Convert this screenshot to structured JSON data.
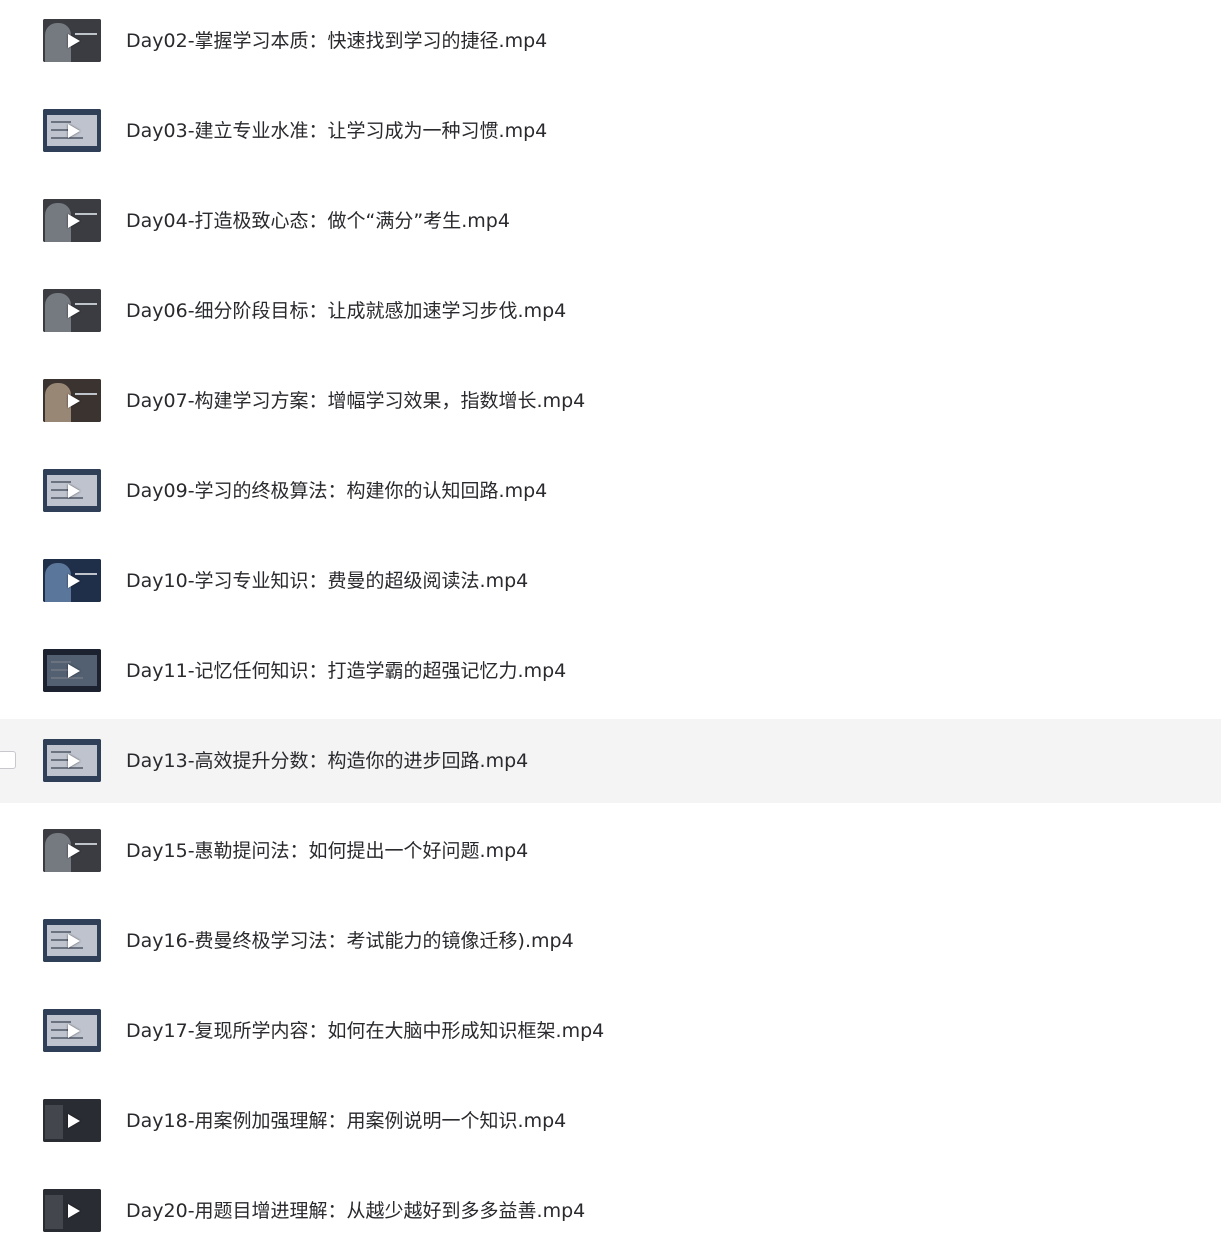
{
  "files": [
    {
      "name": "Day02-掌握学习本质：快速找到学习的捷径.mp4",
      "thumb": "portrait-dark",
      "thumbnail_icon": "play-icon"
    },
    {
      "name": "Day03-建立专业水准：让学习成为一种习惯.mp4",
      "thumb": "slide-light",
      "thumbnail_icon": "play-icon"
    },
    {
      "name": "Day04-打造极致心态：做个“满分”考生.mp4",
      "thumb": "portrait-dark",
      "thumbnail_icon": "play-icon"
    },
    {
      "name": "Day06-细分阶段目标：让成就感加速学习步伐.mp4",
      "thumb": "portrait-dark",
      "thumbnail_icon": "play-icon"
    },
    {
      "name": "Day07-构建学习方案：增幅学习效果，指数增长.mp4",
      "thumb": "portrait-slide",
      "thumbnail_icon": "play-icon"
    },
    {
      "name": "Day09-学习的终极算法：构建你的认知回路.mp4",
      "thumb": "slide-light",
      "thumbnail_icon": "play-icon"
    },
    {
      "name": "Day10-学习专业知识：费曼的超级阅读法.mp4",
      "thumb": "portrait-blue",
      "thumbnail_icon": "play-icon"
    },
    {
      "name": "Day11-记忆任何知识：打造学霸的超强记忆力.mp4",
      "thumb": "slide-dark",
      "thumbnail_icon": "play-icon"
    },
    {
      "name": "Day13-高效提升分数：构造你的进步回路.mp4",
      "thumb": "slide-light",
      "thumbnail_icon": "play-icon",
      "hover": true
    },
    {
      "name": "Day15-惠勒提问法：如何提出一个好问题.mp4",
      "thumb": "portrait-dark",
      "thumbnail_icon": "play-icon"
    },
    {
      "name": "Day16-费曼终极学习法：考试能力的镜像迁移).mp4",
      "thumb": "slide-light",
      "thumbnail_icon": "play-icon"
    },
    {
      "name": "Day17-复现所学内容：如何在大脑中形成知识框架.mp4",
      "thumb": "slide-light",
      "thumbnail_icon": "play-icon"
    },
    {
      "name": "Day18-用案例加强理解：用案例说明一个知识.mp4",
      "thumb": "plain-dark",
      "thumbnail_icon": "play-icon"
    },
    {
      "name": "Day20-用题目增进理解：从越少越好到多多益善.mp4",
      "thumb": "plain-dark",
      "thumbnail_icon": "play-icon"
    }
  ],
  "colors": {
    "text": "#2a2a2e",
    "hover_row": "#f4f4f5",
    "thumb_dark": "#2b2d33"
  }
}
